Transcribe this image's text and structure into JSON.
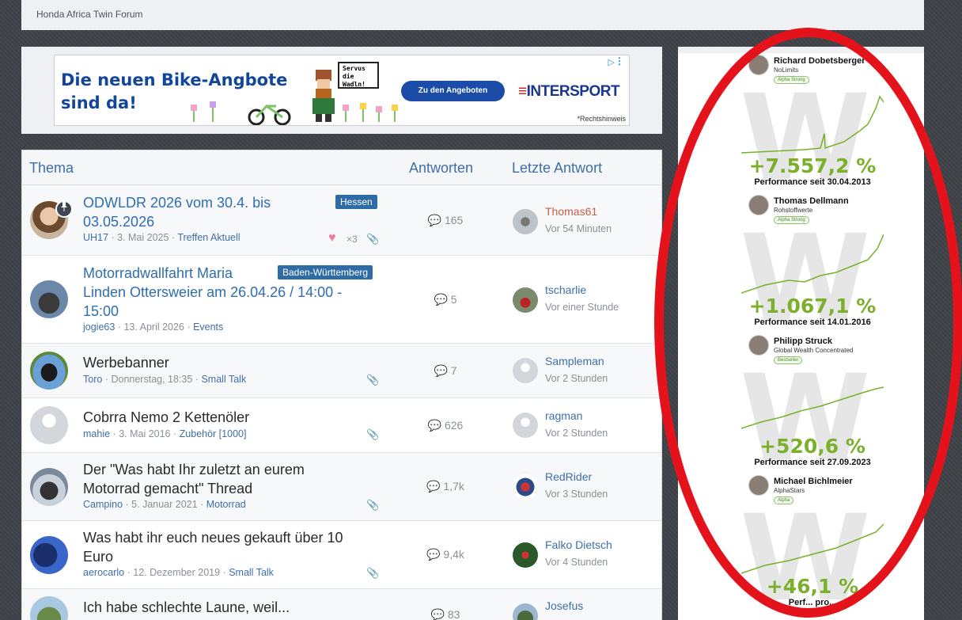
{
  "forum": {
    "name": "Honda Africa Twin Forum"
  },
  "ad": {
    "headline_line1": "Die neuen Bike-Angbote",
    "headline_line2": "sind da!",
    "bubble_text": "Servus die Wadln!",
    "cta": "Zu den Angeboten",
    "brand": "INTERSPORT",
    "brand_mark": "≡",
    "note": "*Rechtshinweis",
    "info_icon": "▷",
    "menu_icon": "⋮"
  },
  "columns": {
    "topic": "Thema",
    "replies": "Antworten",
    "last": "Letzte Antwort"
  },
  "threads": [
    {
      "title_l1": "ODWLDR 2026 vom 30.4. bis",
      "title_l2": "03.05.2026",
      "title_l3": "",
      "prefix": "Hessen",
      "author": "UH17",
      "date": "3. Mai 2025",
      "forum": "Treffen Aktuell",
      "replies": "165",
      "last_user": "Thomas61",
      "last_time": "Vor 54 Minuten",
      "likes": "×3"
    },
    {
      "title_l1": "Motorradwallfahrt Maria",
      "title_l2": "Linden Ottersweier am 26.04.26 / 14:00 -",
      "title_l3": "15:00",
      "prefix": "Baden-Württemberg",
      "author": "jogie63",
      "date": "13. April 2026",
      "forum": "Events",
      "replies": "5",
      "last_user": "tscharlie",
      "last_time": "Vor einer Stunde"
    },
    {
      "title_l1": "Werbebanner",
      "title_l2": "",
      "title_l3": "",
      "author": "Toro",
      "date": "Donnerstag, 18:35",
      "forum": "Small Talk",
      "replies": "7",
      "last_user": "Sampleman",
      "last_time": "Vor 2 Stunden"
    },
    {
      "title_l1": "Cobrra Nemo 2 Kettenöler",
      "title_l2": "",
      "title_l3": "",
      "author": "mahie",
      "date": "3. Mai 2016",
      "forum": "Zubehör [1000]",
      "replies": "626",
      "last_user": "ragman",
      "last_time": "Vor 2 Stunden"
    },
    {
      "title_l1": "Der \"Was habt Ihr zuletzt an eurem",
      "title_l2": "Motorrad gemacht\" Thread",
      "title_l3": "",
      "author": "Campino",
      "date": "5. Januar 2021",
      "forum": "Motorrad",
      "replies": "1,7k",
      "last_user": "RedRider",
      "last_time": "Vor 3 Stunden"
    },
    {
      "title_l1": "Was habt ihr euch neues gekauft über 10",
      "title_l2": "Euro",
      "title_l3": "",
      "author": "aerocarlo",
      "date": "12. Dezember 2019",
      "forum": "Small Talk",
      "replies": "9,4k",
      "last_user": "Falko Dietsch",
      "last_time": "Vor 4 Stunden"
    },
    {
      "title_l1": "Ich habe schlechte Laune, weil...",
      "title_l2": "",
      "title_l3": "",
      "replies": "83",
      "last_user": "Josefus"
    }
  ],
  "meta_sep": "·",
  "side_ad": {
    "cards": [
      {
        "name": "Richard Dobetsberger",
        "sub": "NoLimits",
        "tag": "Alpha Strong",
        "pct": "+7.557,2 %",
        "since": "Performance seit 30.04.2013"
      },
      {
        "name": "Thomas Dellmann",
        "sub": "Rohstoffwerte",
        "tag": "Alpha Strong",
        "pct": "+1.067,1 %",
        "since": "Performance seit 14.01.2016"
      },
      {
        "name": "Philipp Struck",
        "sub": "Global Wealth Concentrated",
        "tag": "Bestseller",
        "pct": "+520,6 %",
        "since": "Performance seit 27.09.2023"
      },
      {
        "name": "Michael Bichlmeier",
        "sub": "AlphaStars",
        "tag": "Alpha",
        "pct": "+46,1 %",
        "since": "Perf... pro..."
      }
    ],
    "watermark": "W"
  },
  "icons": {
    "pin": "pin-icon",
    "comment": "comment-icon",
    "attachment": "paperclip-icon",
    "heart": "heart-icon"
  },
  "colors": {
    "link": "#2f6db0",
    "prefix": "#2f6ca5",
    "gain": "#7ab02b",
    "highlight_ring": "#e3121b"
  }
}
